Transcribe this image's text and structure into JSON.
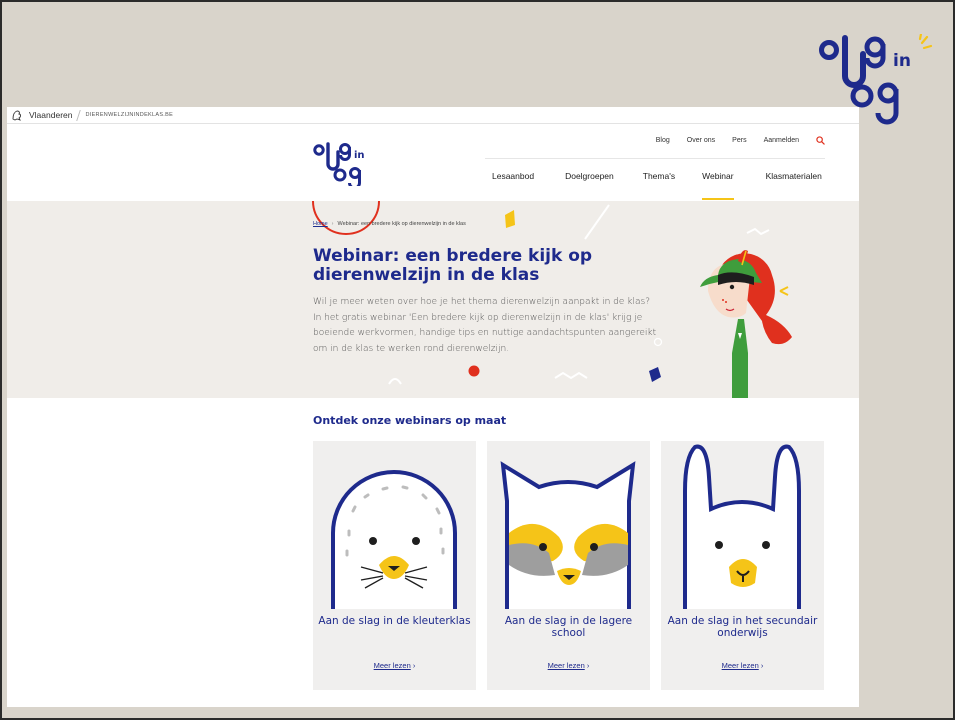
{
  "gov_bar": {
    "name": "Vlaanderen",
    "domain": "DIERENWELZIJNINDEKLAS.BE"
  },
  "brand": {
    "logo_text": [
      "o",
      "9",
      "in",
      "og"
    ],
    "colors": {
      "navy": "#1e2a8c",
      "yellow": "#f5c418",
      "red": "#e0301e",
      "beige": "#d9d4cb",
      "hero_bg": "#f0ede9"
    }
  },
  "util_nav": {
    "items": [
      "Blog",
      "Over ons",
      "Pers",
      "Aanmelden"
    ],
    "search_icon": "search-icon"
  },
  "main_nav": {
    "items": [
      "Lesaanbod",
      "Doelgroepen",
      "Thema's",
      "Webinar",
      "Klasmaterialen"
    ],
    "active": "Webinar"
  },
  "breadcrumb": {
    "home": "Home",
    "current": "Webinar: een bredere kijk op dierenwelzijn in de klas"
  },
  "hero": {
    "title": "Webinar: een bredere kijk op dierenwelzijn in de klas",
    "text": "Wil je meer weten over hoe je het thema dierenwelzijn aanpakt in de klas? In het gratis webinar 'Een bredere kijk op dierenwelzijn in de klas' krijg je boeiende werkvormen, handige tips en nuttige aandachtspunten aangereikt om in de klas te werken rond dierenwelzijn."
  },
  "section": {
    "title": "Ontdek onze webinars op maat"
  },
  "cards": [
    {
      "title": "Aan de slag in de kleuterklas",
      "link": "Meer lezen",
      "icon": "seal-icon"
    },
    {
      "title": "Aan de slag in de lagere school",
      "link": "Meer lezen",
      "icon": "raccoon-icon"
    },
    {
      "title": "Aan de slag in het secundair onderwijs",
      "link": "Meer lezen",
      "icon": "llama-icon"
    }
  ]
}
